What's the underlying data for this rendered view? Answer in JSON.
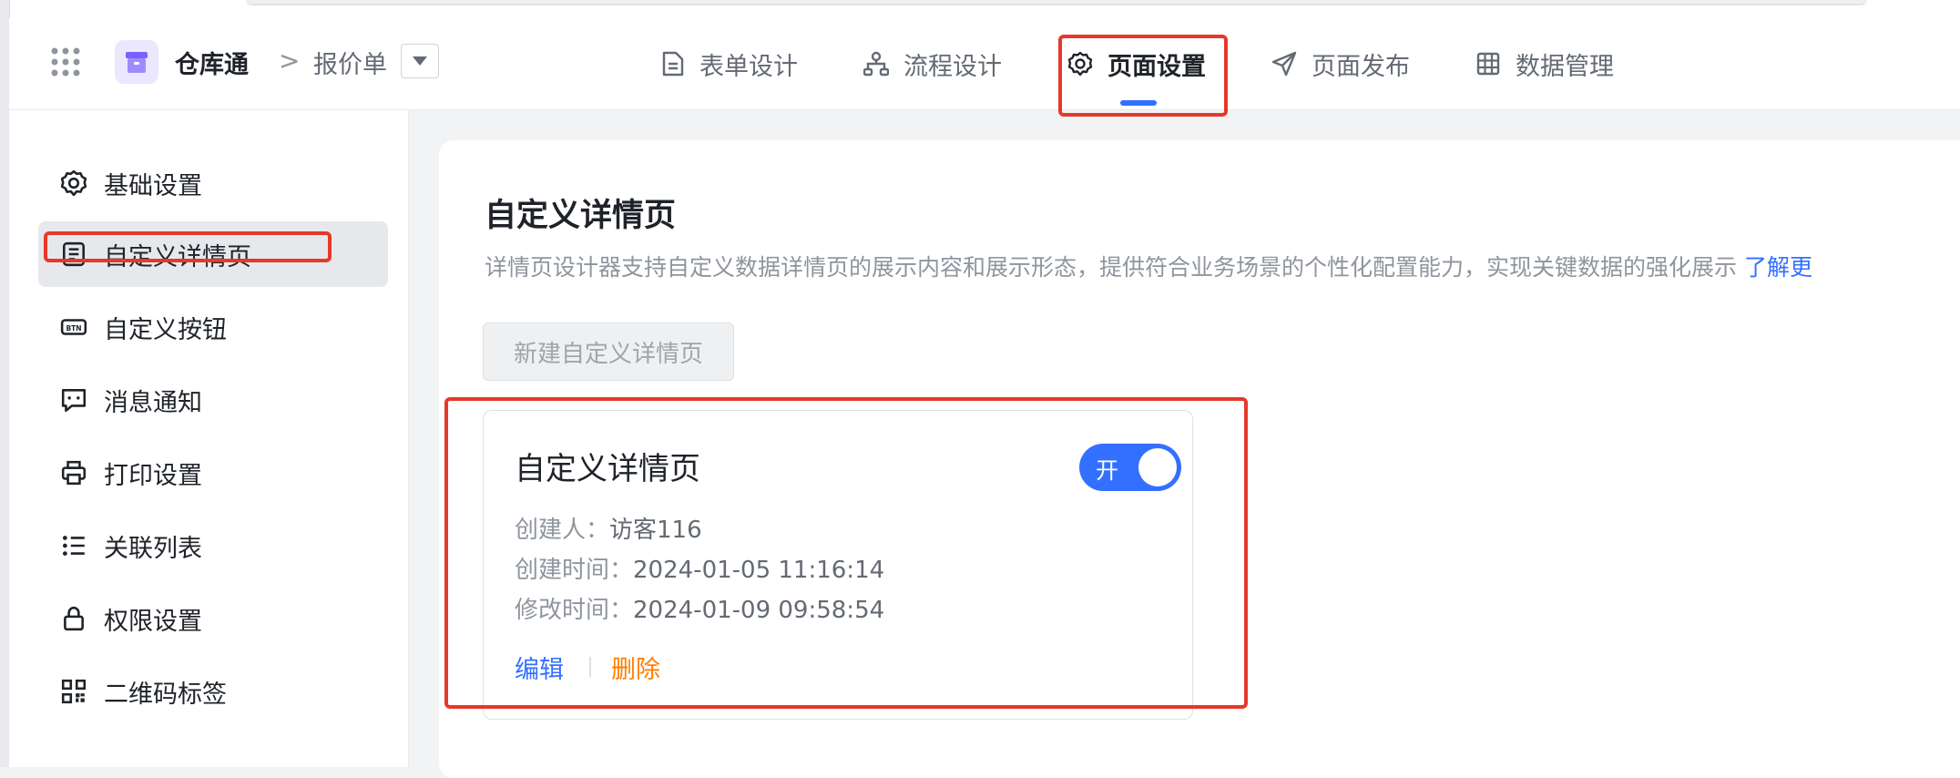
{
  "header": {
    "app_name": "仓库通",
    "breadcrumb_sep": ">",
    "form_name": "报价单",
    "tabs": [
      {
        "label": "表单设计",
        "icon": "document-icon"
      },
      {
        "label": "流程设计",
        "icon": "flowchart-icon"
      },
      {
        "label": "页面设置",
        "icon": "gear-icon",
        "active": true
      },
      {
        "label": "页面发布",
        "icon": "send-icon"
      },
      {
        "label": "数据管理",
        "icon": "table-icon"
      }
    ],
    "accent_color": "#3370ff"
  },
  "sidebar": {
    "items": [
      {
        "label": "基础设置",
        "icon": "gear-icon"
      },
      {
        "label": "自定义详情页",
        "icon": "detail-page-icon",
        "active": true
      },
      {
        "label": "自定义按钮",
        "icon": "btn-icon"
      },
      {
        "label": "消息通知",
        "icon": "message-icon"
      },
      {
        "label": "打印设置",
        "icon": "printer-icon"
      },
      {
        "label": "关联列表",
        "icon": "list-icon"
      },
      {
        "label": "权限设置",
        "icon": "lock-icon"
      },
      {
        "label": "二维码标签",
        "icon": "qrcode-icon"
      }
    ]
  },
  "main": {
    "title": "自定义详情页",
    "description": "详情页设计器支持自定义数据详情页的展示内容和展示形态，提供符合业务场景的个性化配置能力，实现关键数据的强化展示",
    "learn_more": "了解更",
    "new_button": "新建自定义详情页",
    "card": {
      "title": "自定义详情页",
      "toggle_label": "开",
      "toggle_on": true,
      "creator_label": "创建人：",
      "creator": "访客116",
      "created_label": "创建时间：",
      "created_at": "2024-01-05 11:16:14",
      "modified_label": "修改时间：",
      "modified_at": "2024-01-09 09:58:54",
      "edit_label": "编辑",
      "delete_label": "删除"
    }
  },
  "highlight_color": "#e53929"
}
